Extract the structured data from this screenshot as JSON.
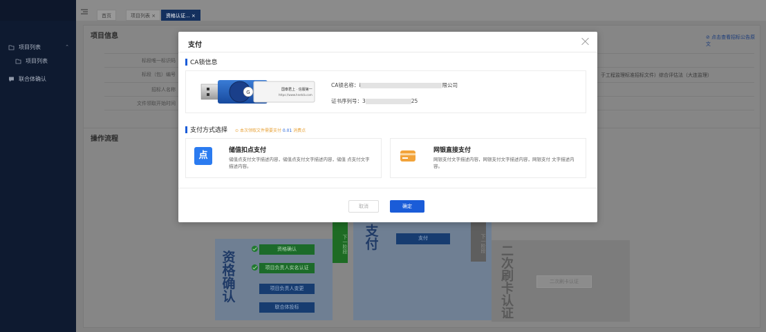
{
  "sidebar": {
    "items": [
      {
        "label": "项目列表",
        "icon": "folder-icon"
      },
      {
        "label": "项目列表",
        "icon": "folder-icon"
      },
      {
        "label": "联合体确认",
        "icon": "message-icon"
      }
    ]
  },
  "tabs": [
    {
      "label": "首页"
    },
    {
      "label": "项目列表 ×"
    },
    {
      "label": "资格认证... ×"
    }
  ],
  "background": {
    "project_info_title": "项目信息",
    "fields": [
      "标段唯一标识码",
      "标段（包）编号",
      "招标人名称",
      "文件领取开始时间"
    ],
    "notice_link": "点击查看招标公告原文",
    "method_text": "于工程监理标准招标文件）综合评估法（大连监理）",
    "flow_title": "操作流程",
    "stage1": "资格确认",
    "stage1_steps": [
      "资格确认",
      "项目负责人实名认证",
      "项目负责人变更",
      "联合体投标"
    ],
    "next_stage": "下一阶段",
    "stage2": "支付",
    "stage2_button": "支付",
    "stage3": "二次刷卡认证",
    "stage3_button": "二次刷卡认证"
  },
  "modal": {
    "title": "支付",
    "ca_section": "CA锁信息",
    "usb_brand": "国泰君上 · 信服第一",
    "usb_url": "https://www.hnetcb.com",
    "ca_name_label": "CA锁名称：",
    "ca_name_prefix": "i",
    "ca_name_suffix": "限公司",
    "cert_label": "证书序列号：",
    "cert_prefix": "3",
    "cert_suffix": "25",
    "pay_section": "支付方式选择",
    "pay_note_prefix": "本次领取文件需要支付",
    "pay_note_amount": "0.01",
    "pay_note_suffix": "消费点",
    "methods": [
      {
        "name": "储值扣点支付",
        "icon_char": "点",
        "desc": "储值点支付文字描述内容，储值点支付文字描述内容，储值 点支付文字描述内容。"
      },
      {
        "name": "网银直接支付",
        "desc": "网银支付文字描述内容，网银支付文字描述内容，网银支付 文字描述内容。"
      }
    ],
    "cancel": "取消",
    "confirm": "确定"
  },
  "colors": {
    "primary": "#1a5cd8",
    "note_orange": "#e8a33a",
    "sidebar_bg": "#0e1a30",
    "card_icon_blue": "#2b7bf0",
    "card_icon_orange": "#f2a33a"
  }
}
